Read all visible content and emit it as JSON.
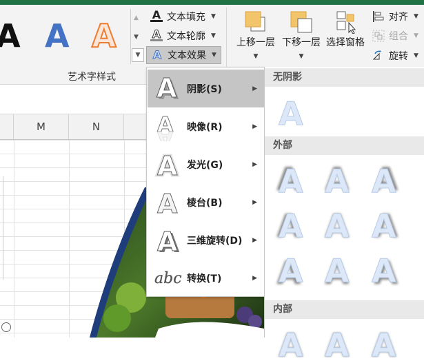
{
  "ribbon": {
    "gallery": {
      "letter": "A"
    },
    "text_fill": {
      "label": "文本填充",
      "icon_letter": "A"
    },
    "text_outline": {
      "label": "文本轮廓",
      "icon_letter": "A"
    },
    "text_effects": {
      "label": "文本效果",
      "icon_letter": "A"
    },
    "group_label": "艺术字样式",
    "bring_forward": "上移一层",
    "send_backward": "下移一层",
    "selection_pane": "选择窗格",
    "align": "对齐",
    "group": "组合",
    "rotate": "旋转"
  },
  "sheet": {
    "columns": [
      "M",
      "N"
    ]
  },
  "menu": {
    "items": [
      {
        "label": "阴影(S)",
        "icon": "shadow-a-icon"
      },
      {
        "label": "映像(R)",
        "icon": "reflection-a-icon"
      },
      {
        "label": "发光(G)",
        "icon": "glow-a-icon"
      },
      {
        "label": "棱台(B)",
        "icon": "bevel-a-icon"
      },
      {
        "label": "三维旋转(D)",
        "icon": "3d-rotation-a-icon"
      },
      {
        "label": "转换(T)",
        "icon": "transform-abc-icon"
      }
    ],
    "transform_text": "abc"
  },
  "submenu": {
    "no_shadow": "无阴影",
    "outer": "外部",
    "inner": "内部",
    "swatch_letter": "A"
  },
  "colors": {
    "accent_green": "#217346",
    "gallery_blue": "#4472c4",
    "gallery_orange": "#ed7d31",
    "menu_active": "#c5c5c5"
  }
}
